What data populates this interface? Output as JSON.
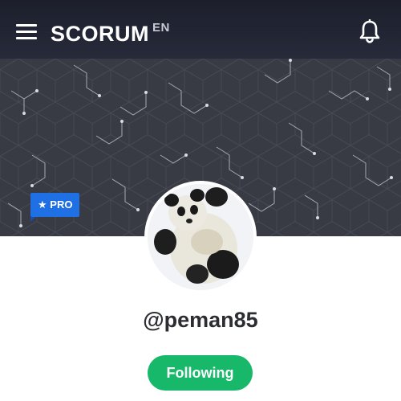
{
  "header": {
    "brand": "SCORUM",
    "language": "EN",
    "menu_icon": "hamburger-menu-icon",
    "notification_icon": "bell-icon",
    "background": "#1c1f2b"
  },
  "profile": {
    "badge_label": "PRO",
    "badge_icon": "star-icon",
    "badge_color": "#1f6fe5",
    "avatar": "panda-avatar",
    "username": "@peman85",
    "follow_button_label": "Following",
    "follow_button_color": "#18b86a"
  }
}
